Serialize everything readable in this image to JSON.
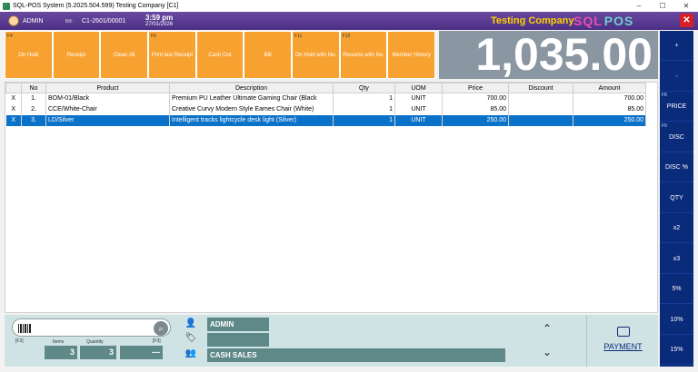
{
  "window": {
    "title": "SQL-POS System (5.2025.504.599) Testing Company [C1]",
    "controls": [
      "–",
      "☐",
      "✕"
    ]
  },
  "header": {
    "user": "ADMIN",
    "bill_label": "Bill :",
    "bill_no": "C1-2601/00001",
    "time": "3:59 pm",
    "date": "27/01/2026",
    "company": "Testing Company",
    "logo_part1": "SQL",
    "logo_part2": "POS",
    "close_label": "✕"
  },
  "function_keys": [
    {
      "key": "F4",
      "label": "On Hold"
    },
    {
      "key": "",
      "label": "Receipt"
    },
    {
      "key": "",
      "label": "Clean All"
    },
    {
      "key": "F6",
      "label": "Print last Receipt"
    },
    {
      "key": "",
      "label": "Cash Out"
    },
    {
      "key": "",
      "label": "Bill"
    },
    {
      "key": "F11",
      "label": "On Hold with No."
    },
    {
      "key": "F12",
      "label": "Resume with No."
    },
    {
      "key": "",
      "label": "Member History"
    }
  ],
  "total": "1,035.00",
  "sidebar": [
    {
      "key": "",
      "label": "+"
    },
    {
      "key": "",
      "label": "-"
    },
    {
      "key": "F8",
      "label": "PRICE"
    },
    {
      "key": "F9",
      "label": "DISC"
    },
    {
      "key": "",
      "label": "DISC %"
    },
    {
      "key": "",
      "label": "QTY"
    },
    {
      "key": "",
      "label": "x2"
    },
    {
      "key": "",
      "label": "x3"
    },
    {
      "key": "",
      "label": "5%"
    },
    {
      "key": "",
      "label": "10%"
    },
    {
      "key": "",
      "label": "15%"
    }
  ],
  "table": {
    "columns": [
      "",
      "No",
      "Product",
      "Description",
      "Qty",
      "UOM",
      "Price",
      "Discount",
      "Amount"
    ],
    "rows": [
      {
        "x": "X",
        "no": "1.",
        "product": "BOM-01/Black",
        "description": "Premium PU Leather Ultimate Gaming Chair (Black",
        "qty": "1",
        "uom": "UNIT",
        "price": "700.00",
        "discount": "",
        "amount": "700.00",
        "selected": false
      },
      {
        "x": "X",
        "no": "2.",
        "product": "CCE/White-Chair",
        "description": "Creative Curvy Modern Style Eames Chair (White)",
        "qty": "1",
        "uom": "UNIT",
        "price": "85.00",
        "discount": "",
        "amount": "85.00",
        "selected": false
      },
      {
        "x": "X",
        "no": "3.",
        "product": "LD/Silver",
        "description": "Intelligent tracks lightcycle desk light (Silver)",
        "qty": "1",
        "uom": "UNIT",
        "price": "250.00",
        "discount": "",
        "amount": "250.00",
        "selected": true
      }
    ]
  },
  "bottom": {
    "scan_placeholder": "",
    "f2_label": "[F2]",
    "f3_label": "[F3]",
    "items_label": "Items",
    "quantity_label": "Quantity",
    "items_value": "3",
    "quantity_value": "3",
    "third_value": "---",
    "cashier": "ADMIN",
    "member": "",
    "customer": "CASH SALES",
    "payment_label": "PAYMENT",
    "up_arrow": "⌃",
    "down_arrow": "⌄",
    "search_icon": "⌕"
  }
}
